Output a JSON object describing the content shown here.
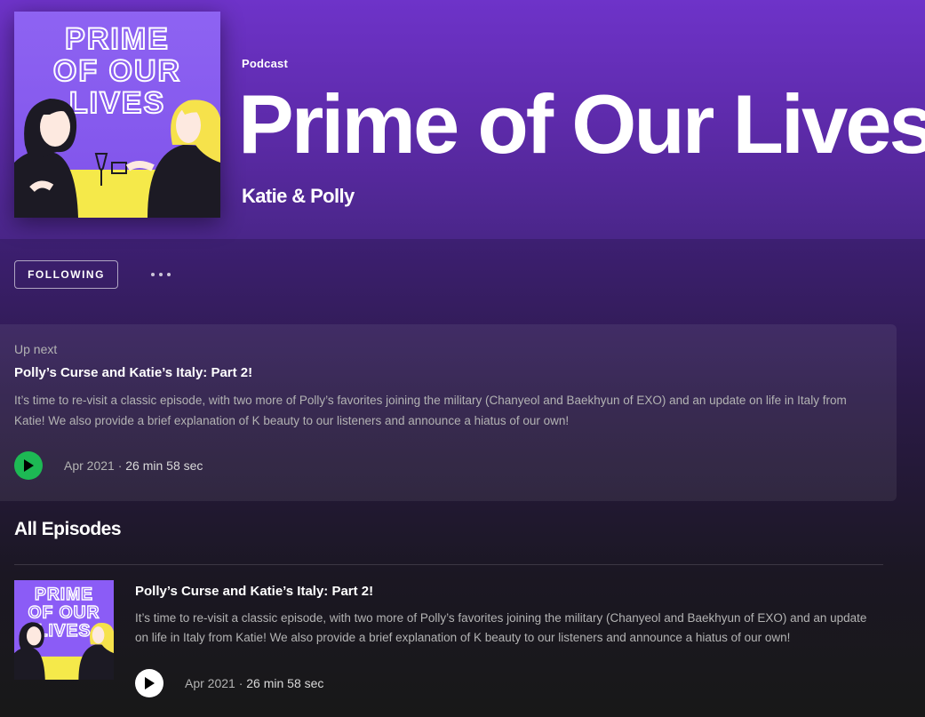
{
  "header": {
    "type_label": "Podcast",
    "title": "Prime of Our Lives",
    "author": "Katie & Polly",
    "cover_text": [
      "PRIME",
      "OF OUR",
      "LIVES"
    ]
  },
  "actions": {
    "follow_label": "FOLLOWING",
    "more_icon": "more-horizontal-icon"
  },
  "up_next": {
    "label": "Up next",
    "episode": {
      "title": "Polly’s Curse and Katie’s Italy: Part 2!",
      "description": "It’s time to re-visit a classic episode, with two more of Polly’s favorites joining the military (Chanyeol and Baekhyun of EXO) and an update on life in Italy from Katie! We also provide a brief explanation of K beauty to our listeners and announce a hiatus of our own!",
      "date": "Apr 2021 · ",
      "duration": "26 min 58 sec"
    }
  },
  "episodes": {
    "heading": "All Episodes",
    "items": [
      {
        "title": "Polly’s Curse and Katie’s Italy: Part 2!",
        "description": "It’s time to re-visit a classic episode, with two more of Polly’s favorites joining the military (Chanyeol and Baekhyun of EXO) and an update on life in Italy from Katie! We also provide a brief explanation of K beauty to our listeners and announce a hiatus of our own!",
        "date": "Apr 2021 · ",
        "duration": "26 min 58 sec"
      }
    ]
  },
  "colors": {
    "accent_green": "#1db954",
    "header_purple": "#6e33c9",
    "cover_purple": "#8b5cf6",
    "cover_yellow": "#f5e94a",
    "cover_hair_blonde": "#f6e24b"
  }
}
